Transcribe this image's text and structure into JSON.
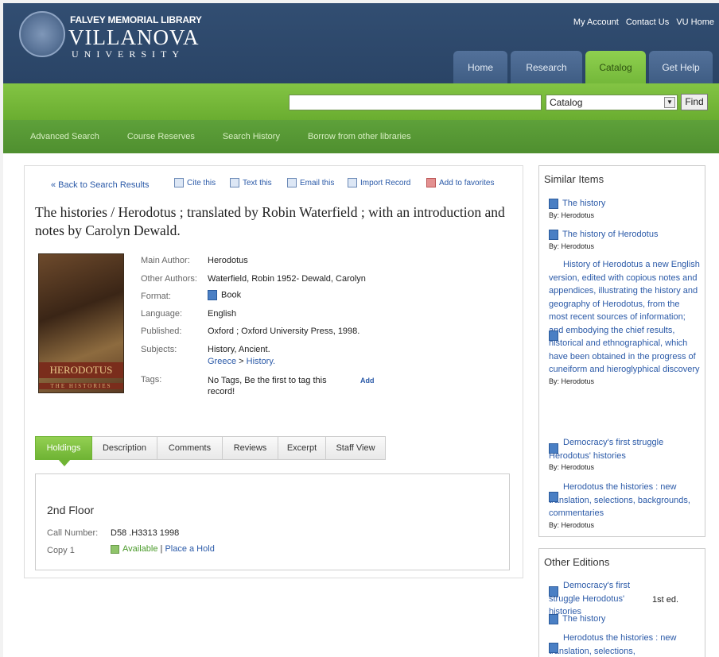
{
  "header": {
    "logo_sub": "FALVEY MEMORIAL LIBRARY",
    "logo_main": "VILLANOVA",
    "logo_univ": "UNIVERSITY",
    "top_links": [
      "My Account",
      "Contact Us",
      "VU Home"
    ],
    "tabs": [
      {
        "label": "Home"
      },
      {
        "label": "Research"
      },
      {
        "label": "Catalog"
      },
      {
        "label": "Get Help"
      }
    ]
  },
  "search": {
    "query": "",
    "scope": "Catalog",
    "find_label": "Find"
  },
  "subnav": [
    "Advanced Search",
    "Course Reserves",
    "Search History",
    "Borrow from other libraries"
  ],
  "toolbar": {
    "back": "« Back to Search Results",
    "cite": "Cite this",
    "text": "Text this",
    "email": "Email this",
    "import": "Import Record",
    "favorites": "Add to favorites"
  },
  "record": {
    "title": "The histories / Herodotus ; translated by Robin Waterfield ; with an introduction and notes by Carolyn Dewald.",
    "cover_title": "HERODOTUS",
    "cover_sub": "THE HISTORIES",
    "fields": {
      "main_author_label": "Main Author:",
      "main_author": "Herodotus",
      "other_authors_label": "Other Authors:",
      "other_authors": "Waterfield, Robin 1952- Dewald, Carolyn",
      "format_label": "Format:",
      "format": "Book",
      "language_label": "Language:",
      "language": "English",
      "published_label": "Published:",
      "published": "Oxford ; Oxford University Press, 1998.",
      "subjects_label": "Subjects:",
      "subject1": "History, Ancient.",
      "subject2_a": "Greece",
      "subject2_sep": " > ",
      "subject2_b": "History.",
      "tags_label": "Tags:",
      "tags": "No Tags, Be the first to tag this record!",
      "add_label": "Add"
    }
  },
  "tabs": [
    "Holdings",
    "Description",
    "Comments",
    "Reviews",
    "Excerpt",
    "Staff View"
  ],
  "holdings": {
    "location": "2nd Floor",
    "call_label": "Call Number:",
    "call_number": "D58 .H3313 1998",
    "copy_label": "Copy 1",
    "status": "Available",
    "separator": "|",
    "hold_link": "Place a Hold"
  },
  "similar": {
    "title": "Similar Items",
    "items": [
      {
        "title": "The history",
        "by": "By: Herodotus"
      },
      {
        "title": "The history of Herodotus",
        "by": "By: Herodotus"
      },
      {
        "title": "History of Herodotus a new English version, edited with copious notes and appendices, illustrating the history and geography of Herodotus, from the most recent sources of information; and embodying the chief results, historical and ethnographical, which have been obtained in the progress of cuneiform and hieroglyphical discovery",
        "by": "By: Herodotus"
      },
      {
        "title": "Democracy's first struggle Herodotus' histories",
        "by": "By: Herodotus"
      },
      {
        "title": "Herodotus the histories : new translation, selections, backgrounds, commentaries",
        "by": "By: Herodotus"
      }
    ]
  },
  "editions": {
    "title": "Other Editions",
    "items": [
      {
        "title": "Democracy's first struggle Herodotus' histories",
        "edition": "1st ed."
      },
      {
        "title": "The history"
      },
      {
        "title": "Herodotus the histories : new translation, selections,"
      }
    ]
  }
}
